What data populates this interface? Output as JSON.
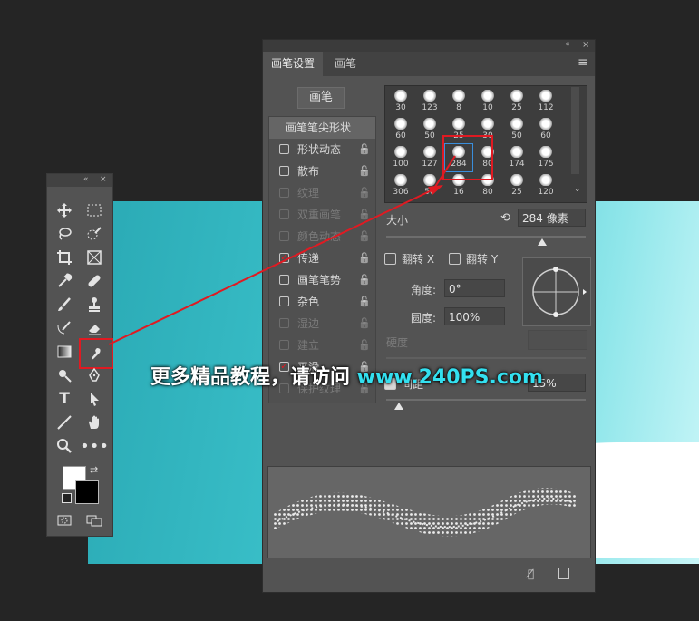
{
  "toolbox": {
    "collapse_icon": "«",
    "close_icon": "×"
  },
  "panel": {
    "collapse_icon": "«",
    "close_icon": "×",
    "menu_icon": "≡",
    "tabs": [
      {
        "label": "画笔设置"
      },
      {
        "label": "画笔"
      }
    ],
    "brush_button": "画笔",
    "options": [
      {
        "label": "画笔笔尖形状",
        "checked": null,
        "enabled": true
      },
      {
        "label": "形状动态",
        "checked": false,
        "enabled": true
      },
      {
        "label": "散布",
        "checked": false,
        "enabled": true
      },
      {
        "label": "纹理",
        "checked": false,
        "enabled": false
      },
      {
        "label": "双重画笔",
        "checked": false,
        "enabled": false
      },
      {
        "label": "颜色动态",
        "checked": false,
        "enabled": false
      },
      {
        "label": "传递",
        "checked": true,
        "enabled": true
      },
      {
        "label": "画笔笔势",
        "checked": false,
        "enabled": true
      },
      {
        "label": "杂色",
        "checked": false,
        "enabled": true
      },
      {
        "label": "湿边",
        "checked": false,
        "enabled": false
      },
      {
        "label": "建立",
        "checked": false,
        "enabled": false
      },
      {
        "label": "平滑",
        "checked": true,
        "enabled": true
      },
      {
        "label": "保护纹理",
        "checked": false,
        "enabled": false
      }
    ],
    "brush_sizes": [
      "30",
      "123",
      "8",
      "10",
      "25",
      "112",
      "60",
      "50",
      "25",
      "30",
      "50",
      "60",
      "100",
      "127",
      "284",
      "80",
      "174",
      "175",
      "306",
      "50",
      "16",
      "80",
      "25",
      "120"
    ],
    "selected_brush": "284",
    "size_label": "大小",
    "size_value": "284 像素",
    "flip_x": "翻转 X",
    "flip_y": "翻转 Y",
    "angle_label": "角度:",
    "angle_value": "0°",
    "roundness_label": "圆度:",
    "roundness_value": "100%",
    "hardness_label": "硬度",
    "spacing_label": "间距",
    "spacing_value": "15%"
  },
  "watermark": {
    "text": "更多精品教程，请访问 ",
    "site": "www.240PS.com"
  },
  "colors": {
    "accent_red": "#e01a22",
    "selection_blue": "#3a8edb",
    "canvas_teal": "#2aa9b4"
  }
}
